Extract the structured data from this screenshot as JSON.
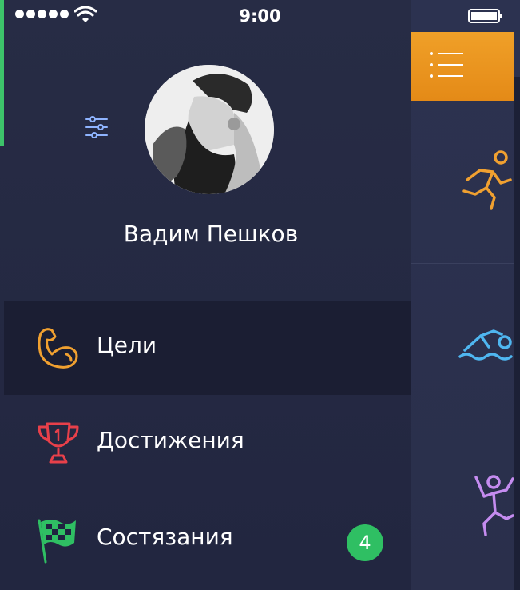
{
  "status_bar": {
    "time": "9:00"
  },
  "profile": {
    "name": "Вадим Пешков"
  },
  "menu": {
    "items": [
      {
        "label": "Цели",
        "icon": "bicep-icon",
        "active": true
      },
      {
        "label": "Достижения",
        "icon": "trophy-icon",
        "active": false
      },
      {
        "label": "Состязания",
        "icon": "checkered-flag-icon",
        "active": false,
        "badge": "4"
      }
    ]
  },
  "colors": {
    "accent_orange": "#e8901a",
    "badge_green": "#2fbf63",
    "drawer_bg": "#272c45",
    "active_item_bg": "#1b1e33"
  },
  "activities": [
    {
      "icon": "running-icon",
      "color": "#f0a030"
    },
    {
      "icon": "swimming-icon",
      "color": "#4fb6f0"
    },
    {
      "icon": "climbing-icon",
      "color": "#c58cf0"
    }
  ]
}
